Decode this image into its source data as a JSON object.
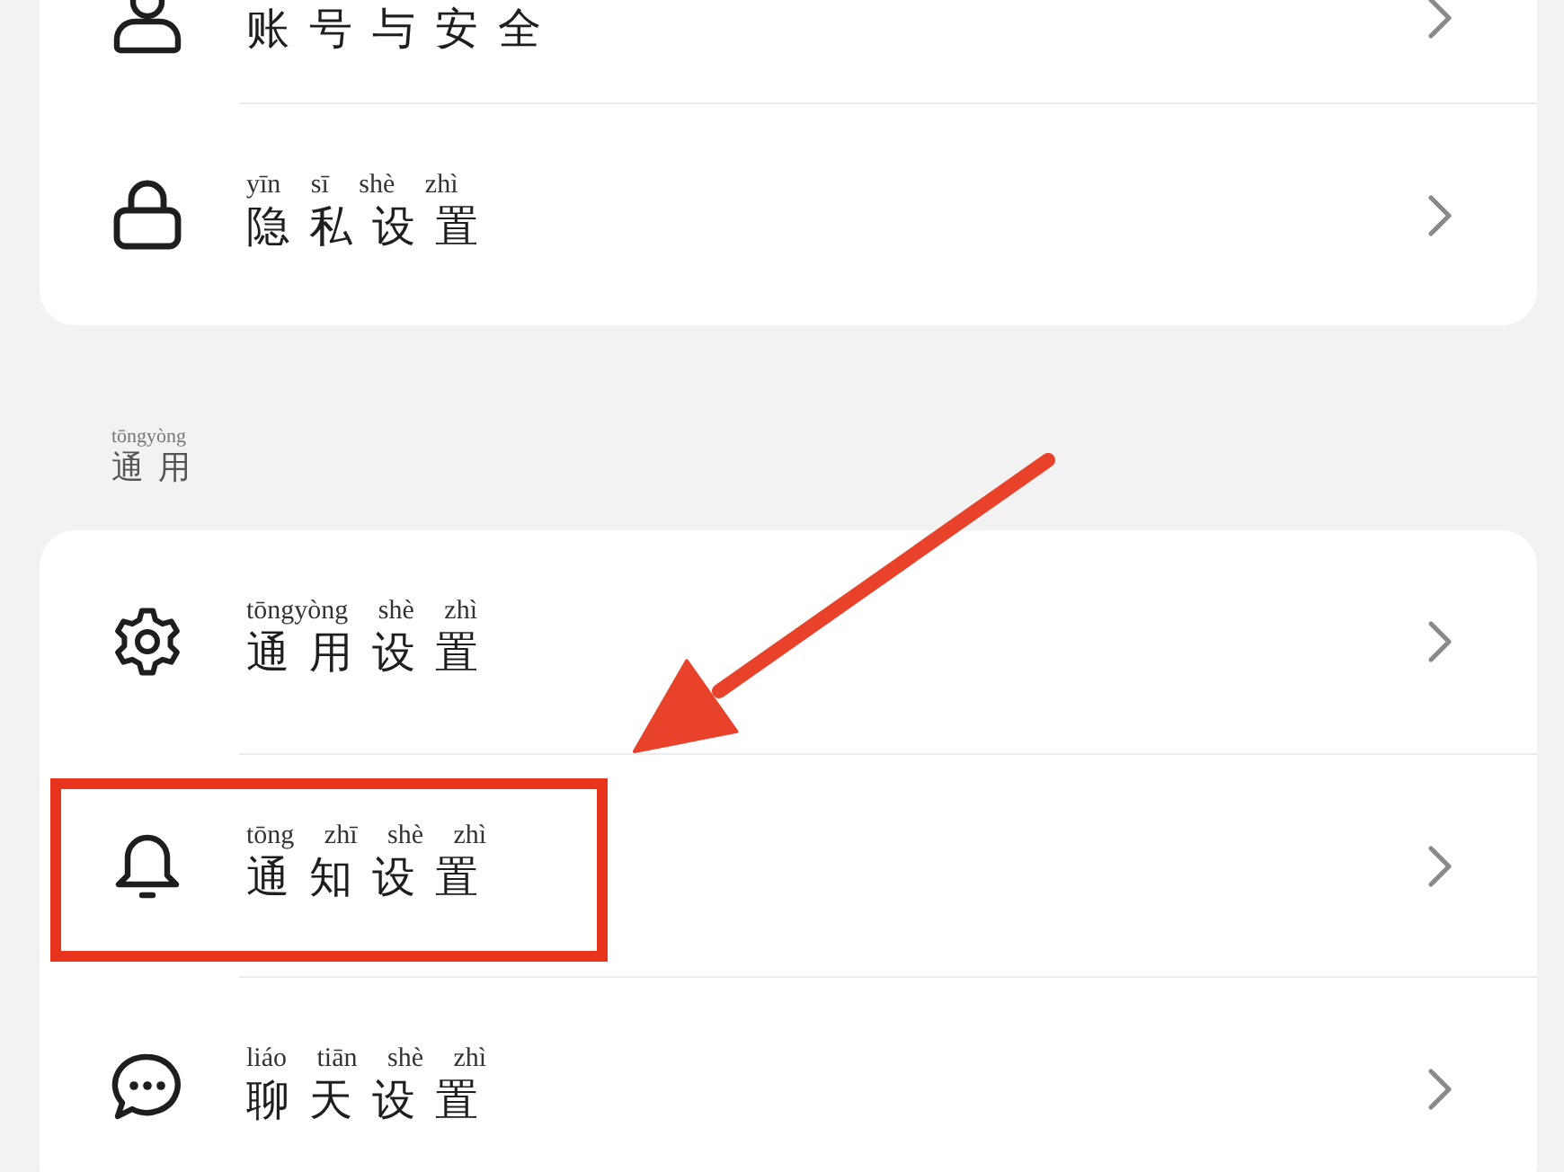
{
  "sections": [
    {
      "items": [
        {
          "kind": "person",
          "label": "账号与安全",
          "highlighted": false
        },
        {
          "kind": "lock",
          "pinyin": "yīn sī shè zhì",
          "label": "隐私设置",
          "highlighted": false
        }
      ]
    },
    {
      "header": {
        "pinyin": "tōngyòng",
        "label": "通用"
      },
      "items": [
        {
          "kind": "gear",
          "pinyin": "tōngyòng shè zhì",
          "label": "通用设置",
          "highlighted": false
        },
        {
          "kind": "bell",
          "pinyin": "tōng zhī shè zhì",
          "label": "通知设置",
          "highlighted": true
        },
        {
          "kind": "chat",
          "pinyin": "liáo tiān shè zhì",
          "label": "聊天设置",
          "highlighted": false
        }
      ]
    }
  ]
}
